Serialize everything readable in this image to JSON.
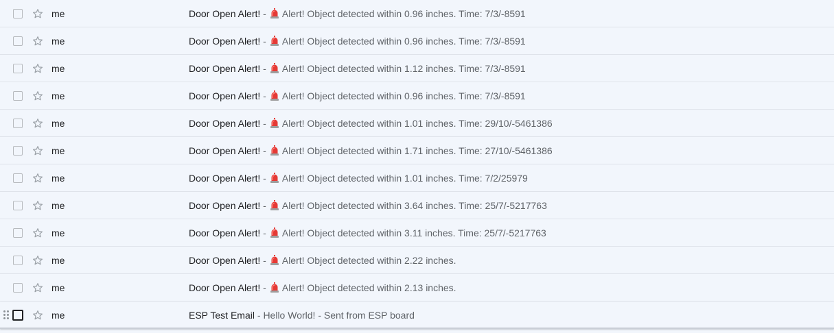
{
  "colors": {
    "background": "#f2f6fc",
    "divider": "#dfe3ea",
    "text_primary": "#202124",
    "text_secondary": "#5f6368",
    "siren_red": "#e53935"
  },
  "rows": [
    {
      "sender": "me",
      "subject": "Door Open Alert!",
      "separator": " - ",
      "icon": "siren-icon",
      "snippet": " Alert! Object detected within 0.96 inches. Time: 7/3/-8591"
    },
    {
      "sender": "me",
      "subject": "Door Open Alert!",
      "separator": " - ",
      "icon": "siren-icon",
      "snippet": " Alert! Object detected within 0.96 inches. Time: 7/3/-8591"
    },
    {
      "sender": "me",
      "subject": "Door Open Alert!",
      "separator": " - ",
      "icon": "siren-icon",
      "snippet": " Alert! Object detected within 1.12 inches. Time: 7/3/-8591"
    },
    {
      "sender": "me",
      "subject": "Door Open Alert!",
      "separator": " - ",
      "icon": "siren-icon",
      "snippet": " Alert! Object detected within 0.96 inches. Time: 7/3/-8591"
    },
    {
      "sender": "me",
      "subject": "Door Open Alert!",
      "separator": " - ",
      "icon": "siren-icon",
      "snippet": " Alert! Object detected within 1.01 inches. Time: 29/10/-5461386"
    },
    {
      "sender": "me",
      "subject": "Door Open Alert!",
      "separator": " - ",
      "icon": "siren-icon",
      "snippet": " Alert! Object detected within 1.71 inches. Time: 27/10/-5461386"
    },
    {
      "sender": "me",
      "subject": "Door Open Alert!",
      "separator": " - ",
      "icon": "siren-icon",
      "snippet": " Alert! Object detected within 1.01 inches. Time: 7/2/25979"
    },
    {
      "sender": "me",
      "subject": "Door Open Alert!",
      "separator": " - ",
      "icon": "siren-icon",
      "snippet": " Alert! Object detected within 3.64 inches. Time: 25/7/-5217763"
    },
    {
      "sender": "me",
      "subject": "Door Open Alert!",
      "separator": " - ",
      "icon": "siren-icon",
      "snippet": " Alert! Object detected within 3.11 inches. Time: 25/7/-5217763"
    },
    {
      "sender": "me",
      "subject": "Door Open Alert!",
      "separator": " - ",
      "icon": "siren-icon",
      "snippet": " Alert! Object detected within 2.22 inches."
    },
    {
      "sender": "me",
      "subject": "Door Open Alert!",
      "separator": " - ",
      "icon": "siren-icon",
      "snippet": " Alert! Object detected within 2.13 inches."
    },
    {
      "sender": "me",
      "subject": "ESP Test Email",
      "separator": " - ",
      "icon": "",
      "snippet": "Hello World! - Sent from ESP board",
      "hovered": true
    }
  ]
}
